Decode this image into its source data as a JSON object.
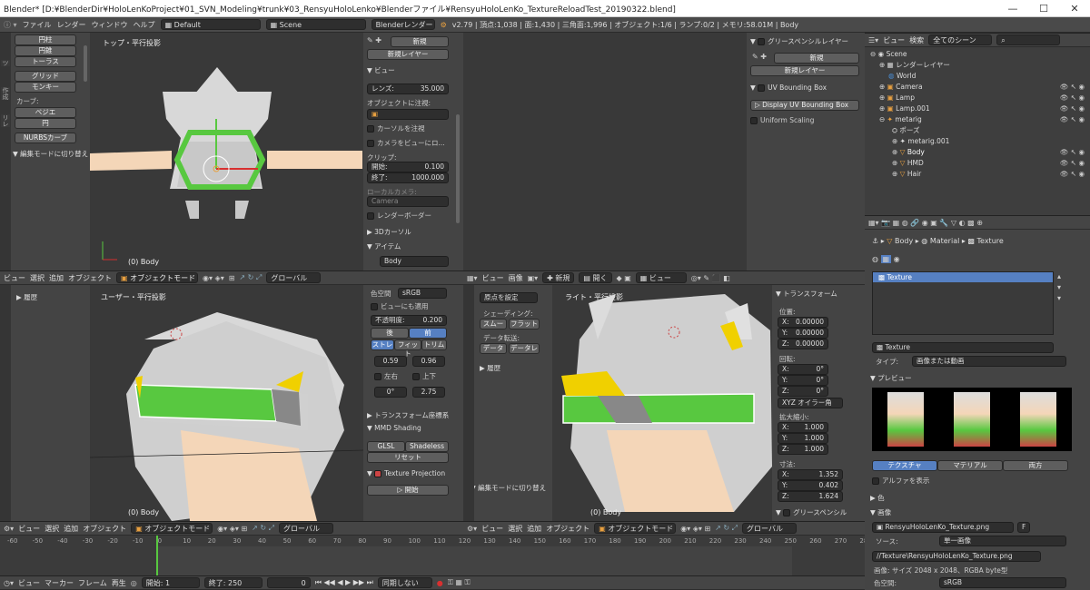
{
  "title_bar": {
    "text": "Blender* [D:¥BlenderDir¥HoloLenKoProject¥01_SVN_Modeling¥trunk¥03_RensyuHoloLenko¥Blenderファイル¥RensyuHoloLenKo_TextureReloadTest_20190322.blend]",
    "minimize": "—",
    "maximize": "☐",
    "close": "✕"
  },
  "info_bar": {
    "menus": [
      "ファイル",
      "レンダー",
      "ウィンドウ",
      "ヘルプ"
    ],
    "layout": "Default",
    "scene": "Scene",
    "engine": "Blenderレンダー",
    "stats": "v2.79 | 頂点:1,038 | 面:1,430 | 三角面:1,996 | オブジェクト:1/6 | ランプ:0/2 | メモリ:58.01M | Body"
  },
  "tool_shelf": {
    "items": [
      "円柱",
      "円錐",
      "トーラス"
    ],
    "items2": [
      "グリッド",
      "モンキー"
    ],
    "curve_label": "カーブ:",
    "curve_items": [
      "ベジエ",
      "円"
    ],
    "nurbs": "NURBSカーブ",
    "op": "▼ 編集モードに切り替え",
    "tabs": [
      "ツ",
      "作成",
      "リレ",
      "アニ",
      "物理",
      "グリ"
    ]
  },
  "vp_top": {
    "label": "トップ・平行投影",
    "obj": "(0) Body"
  },
  "vp_user": {
    "label": "ユーザー・平行投影",
    "obj": "(0) Body"
  },
  "vp_right": {
    "label": "ライト・平行投影",
    "obj": "(0) Body"
  },
  "n_panel_top": {
    "new_label": "新規",
    "new_layer": "新規レイヤー",
    "view": "ビュー",
    "lens": "レンズ:",
    "lens_value": "35.000",
    "lock_obj": "オブジェクトに注視:",
    "lock_cursor": "カーソルを注視",
    "lock_cam": "カメラをビューにロ...",
    "clip": "クリップ:",
    "clip_start": "開始:",
    "clip_start_v": "0.100",
    "clip_end": "終了:",
    "clip_end_v": "1000.000",
    "local_cam": "ローカルカメラ:",
    "camera": "Camera",
    "render_border": "レンダーボーダー",
    "cursor3d": "3Dカーソル",
    "item": "アイテム",
    "item_name": "Body"
  },
  "n_panel_user": {
    "colorspace": "色空間",
    "colorspace_v": "sRGB",
    "view_apply": "ビューにも適用",
    "opacity": "不透明度:",
    "opacity_v": "0.200",
    "back": "後",
    "front": "前",
    "stretch": "ストレ",
    "fit": "フィット",
    "trim": "トリム",
    "x": "0.59",
    "y": "0.96",
    "flip_x": "左右",
    "flip_y": "上下",
    "rot": "0°",
    "scale": "2.75",
    "transform_orient": "トランスフォーム座標系",
    "mmd_shading": "MMD Shading",
    "glsl": "GLSL",
    "shadeless": "Shadeless",
    "reset": "リセット",
    "texproj": "Texture Projection",
    "start": "開始"
  },
  "header_top": {
    "menus": [
      "ビュー",
      "選択",
      "追加",
      "オブジェクト"
    ],
    "mode": "オブジェクトモード",
    "orient": "グローバル"
  },
  "header_user": {
    "menus": [
      "ビュー",
      "選択",
      "追加",
      "オブジェクト"
    ],
    "mode": "オブジェクトモード",
    "orient": "グローバル"
  },
  "header_right": {
    "menus": [
      "ビュー",
      "選択",
      "追加",
      "オブジェクト"
    ],
    "mode": "オブジェクトモード",
    "orient": "グローバル"
  },
  "uv_header": {
    "menus": [
      "ビュー",
      "画像"
    ],
    "new": "新規",
    "open": "開く",
    "view": "ビュー"
  },
  "gp_panel": {
    "title": "グリースペンシルレイヤー",
    "new": "新規",
    "new_layer": "新規レイヤー",
    "uvbb": "UV Bounding Box",
    "display": "Display UV Bounding Box",
    "uniform": "Uniform Scaling"
  },
  "uv_tools": {
    "origin": "原点を設定",
    "shading": "シェーディング:",
    "smooth": "スムー",
    "flat": "フラット",
    "data_transfer": "データ転送:",
    "data": "データ",
    "data2": "データレ",
    "history": "▶ 履歴",
    "editmode": "▼ 編集モードに切り替え"
  },
  "left_history": "▶ 履歴",
  "transform_panel": {
    "title": "トランスフォーム",
    "loc": "位置:",
    "loc_x": "X:",
    "loc_xv": "0.00000",
    "loc_y": "Y:",
    "loc_yv": "0.00000",
    "loc_z": "Z:",
    "loc_zv": "0.00000",
    "rot": "回転:",
    "rot_xv": "0°",
    "rot_yv": "0°",
    "rot_zv": "0°",
    "rot_mode": "XYZ オイラー角",
    "scale": "拡大縮小:",
    "sc_xv": "1.000",
    "sc_yv": "1.000",
    "sc_zv": "1.000",
    "dim": "寸法:",
    "dim_xv": "1.352",
    "dim_yv": "0.402",
    "dim_zv": "1.624",
    "gp": "グリースペンシル"
  },
  "outliner": {
    "menus": [
      "ビュー",
      "検索"
    ],
    "filter": "全てのシーン",
    "rows": [
      "Scene",
      "レンダーレイヤー",
      "World",
      "Camera",
      "Lamp",
      "Lamp.001",
      "metarig",
      "ポーズ",
      "metarig.001",
      "Body",
      "HMD",
      "Hair"
    ]
  },
  "properties": {
    "path": [
      "Body",
      "Material",
      "Texture"
    ],
    "tex_list_selected": "Texture",
    "tex_name": "Texture",
    "type_label": "タイプ:",
    "type_value": "画像または動画",
    "preview": "プレビュー",
    "tabs": [
      "テクスチャ",
      "マテリアル",
      "両方"
    ],
    "alpha": "アルファを表示",
    "color": "色",
    "image": "画像",
    "image_name": "RensyuHoloLenKo_Texture.png",
    "source": "ソース:",
    "source_value": "単一画像",
    "filepath": "//Texture\\RensyuHoloLenKo_Texture.png",
    "image_info": "画像: サイズ 2048 x 2048、RGBA byte型",
    "colorspace": "色空間:",
    "colorspace_v": "sRGB",
    "f_label": "F"
  },
  "timeline": {
    "ticks": [
      "-60",
      "-50",
      "-40",
      "-30",
      "-20",
      "-10",
      "0",
      "10",
      "20",
      "30",
      "40",
      "50",
      "60",
      "70",
      "80",
      "90",
      "100",
      "110",
      "120",
      "130",
      "140",
      "150",
      "160",
      "170",
      "180",
      "190",
      "200",
      "210",
      "220",
      "230",
      "240",
      "250",
      "260",
      "270",
      "280"
    ],
    "menus": [
      "ビュー",
      "マーカー",
      "フレーム",
      "再生"
    ],
    "start": "開始:",
    "start_v": "1",
    "end": "終了:",
    "end_v": "250",
    "current": "0",
    "sync": "同期しない"
  },
  "colors": {
    "selected": "#5680c2",
    "orange": "#e8a040",
    "green_axis": "#58c840",
    "red_axis": "#d83030"
  }
}
